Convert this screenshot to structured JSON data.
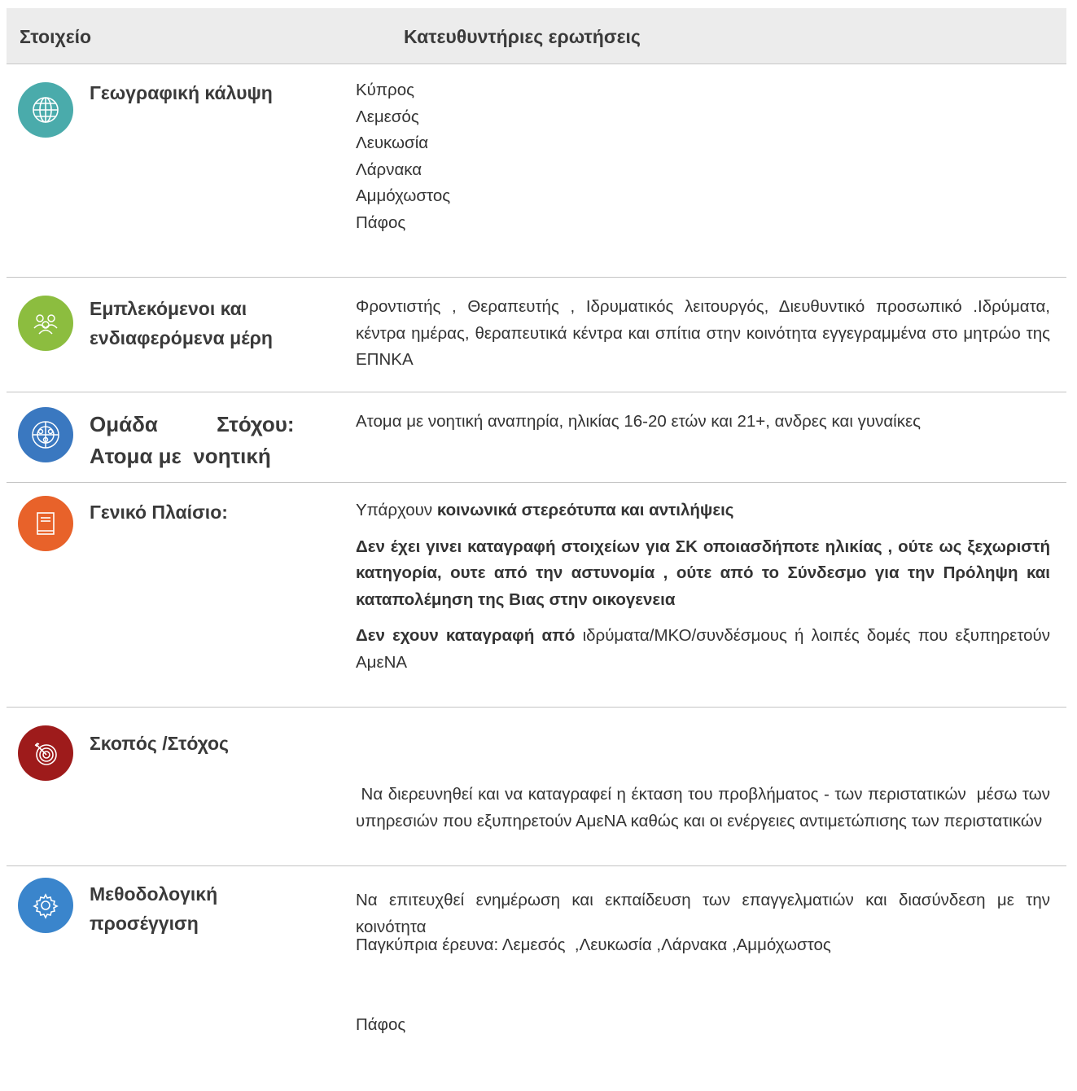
{
  "header": {
    "col1": "Στοιχείο",
    "col2": "Κατευθυντήριες ερωτήσεις"
  },
  "rows": [
    {
      "icon": "globe-icon",
      "color": "#4aabab",
      "title": "Γεωγραφική κάλυψη",
      "lines": [
        "Κύπρος",
        "Λεμεσός",
        "Λευκωσία",
        "Λάρνακα",
        "Αμμόχωστος",
        "Πάφος"
      ]
    },
    {
      "icon": "people-group-icon",
      "color": "#8cbd3f",
      "title_lines": [
        "Εμπλεκόμενοι και",
        "ενδιαφερόμενα μέρη"
      ],
      "text": "Φροντιστής , Θεραπευτής , Ιδρυματικός λειτουργός,  Διευθυντικό προσωπικό .Ιδρύματα, κέντρα ημέρας, θεραπευτικά κέντρα και σπίτια στην κοινότητα εγγεγραμμένα στο μητρώο της ΕΠΝΚΑ"
    },
    {
      "icon": "target-group-icon",
      "color": "#3a78c0",
      "title_lines": [
        "Ομάδα          Στόχου:",
        "Ατομα με  νοητική"
      ],
      "text": "Ατομα με νοητική αναπηρία, ηλικίας 16-20 ετών και 21+, ανδρες και γυναίκες"
    },
    {
      "icon": "book-icon",
      "color": "#e8622a",
      "title": "Γενικό Πλαίσιο:",
      "p1_normal": "Υπάρχουν ",
      "p1_bold": "κοινωνικά στερεότυπα και αντιλήψεις",
      "p2_bold": "Δεν έχει γινει καταγραφή στοιχείων για ΣΚ οποιασδήποτε ηλικίας , ούτε ως ξεχωριστή κατηγορία, ουτε από την αστυνομία , ούτε  από το Σύνδεσμο για την Πρόληψη και καταπολέμηση της Βιας στην οικογενεια",
      "p3_bold": "Δεν εχουν καταγραφή από ",
      "p3_normal": " ιδρύματα/ΜΚΟ/συνδέσμους ή λοιπές δομές που εξυπηρετούν ΑμεΝΑ"
    },
    {
      "icon": "target-arrow-icon",
      "color": "#9e1b1b",
      "title": "Σκοπός /Στόχος",
      "text1": " Να διερευνηθεί και να καταγραφεί η έκταση του προβλήματος - των περιστατικών  μέσω των υπηρεσιών που εξυπηρετούν ΑμεΝΑ καθώς και οι ενέργειες αντιμετώπισης των περιστατικών",
      "text2": "Να επιτευχθεί ενημέρωση και εκπαίδευση των επαγγελματιών και διασύνδεση με την κοινότητα"
    },
    {
      "icon": "gear-icon",
      "color": "#3a85cc",
      "title_lines": [
        "Μεθοδολογική",
        "προσέγγιση"
      ],
      "lines": [
        "Παγκύπρια έρευνα: Λεμεσός  ,Λευκωσία ,Λάρνακα ,Αμμόχωστος",
        "Πάφος"
      ]
    }
  ]
}
